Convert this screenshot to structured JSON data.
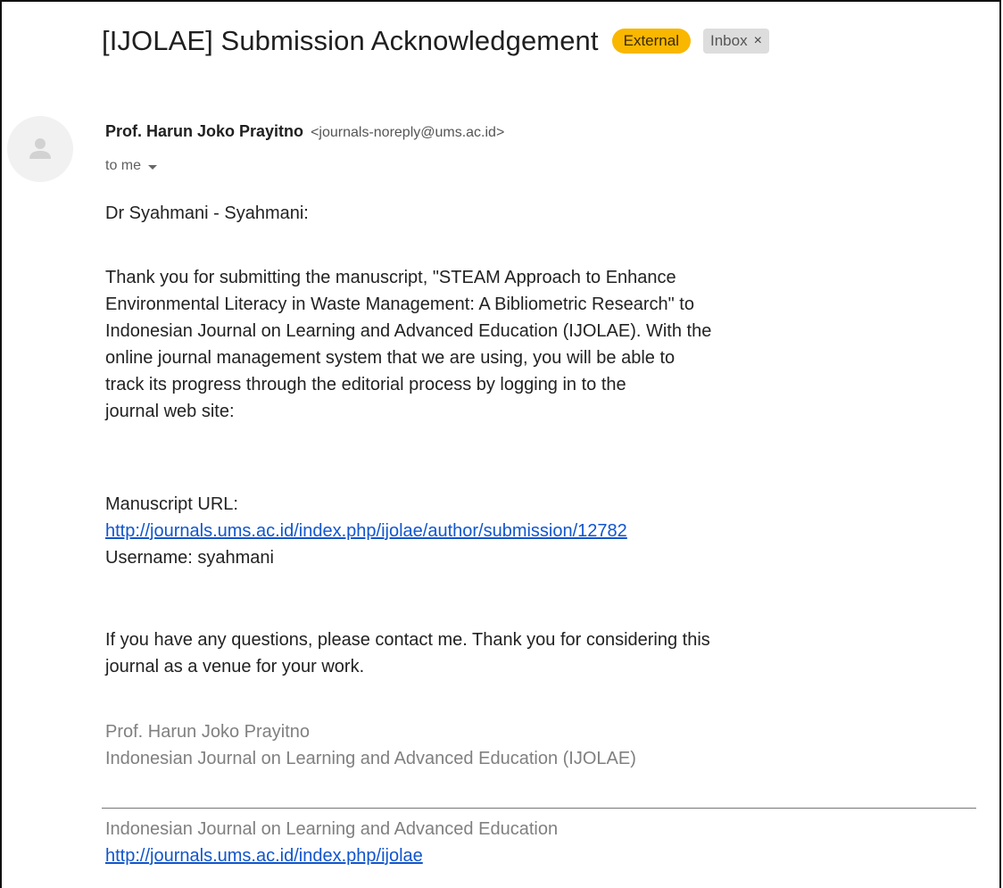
{
  "email": {
    "subject": "[IJOLAE] Submission Acknowledgement",
    "labels": {
      "external": "External",
      "inbox": "Inbox",
      "remove": "×"
    },
    "sender": {
      "name": "Prof. Harun Joko Prayitno",
      "email": "<journals-noreply@ums.ac.id>",
      "avatar_icon": "person-icon"
    },
    "recipient": "to me",
    "body": {
      "greeting": "Dr Syahmani - Syahmani:",
      "paragraph1": [
        "Thank you for submitting the manuscript, \"STEAM Approach to Enhance",
        "Environmental Literacy in Waste Management: A Bibliometric Research\" to",
        "Indonesian Journal on Learning and Advanced Education (IJOLAE). With the",
        "online journal management system that we are using, you will be able to",
        "track its progress through the editorial process by logging in to the",
        "journal web site:"
      ],
      "manuscript_label": "Manuscript URL:",
      "manuscript_url": "http://journals.ums.ac.id/index.php/ijolae/author/submission/12782",
      "username": "Username: syahmani",
      "paragraph2": [
        "If you have any questions, please contact me. Thank you for considering this",
        "journal as a venue for your work."
      ]
    },
    "signature": {
      "name": "Prof. Harun Joko Prayitno",
      "journal": "Indonesian Journal on Learning and Advanced Education (IJOLAE)"
    },
    "footer": {
      "journal": "Indonesian Journal on Learning and Advanced Education",
      "url": "http://journals.ums.ac.id/index.php/ijolae"
    }
  },
  "colors": {
    "external_badge": "#f9b700",
    "inbox_badge": "#dddddd",
    "link": "#1155cc",
    "signature_text": "#808080"
  }
}
